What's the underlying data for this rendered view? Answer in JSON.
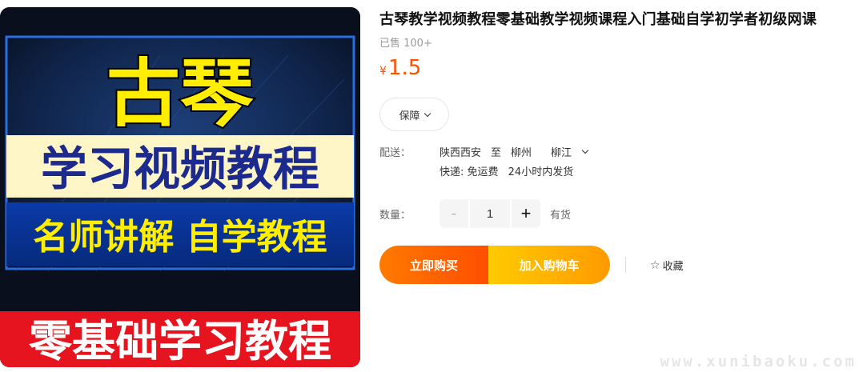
{
  "product": {
    "title": "古琴教学视频教程零基础教学视频课程入门基础自学初学者初级网课",
    "sold": "已售 100+",
    "price_symbol": "¥",
    "price": "1.5",
    "image": {
      "headline": "古琴",
      "subtitle": "学习视频教程",
      "band": "名师讲解 自学教程",
      "footer": "零基础学习教程"
    }
  },
  "guarantee": {
    "label": "保障",
    "icon": "chevron-down-icon"
  },
  "shipping": {
    "label": "配送：",
    "from": "陕西西安",
    "to_word": "至",
    "city": "柳州",
    "district": "柳江",
    "express": "快递: 免运费",
    "dispatch": "24小时内发货"
  },
  "quantity": {
    "label": "数量：",
    "minus": "-",
    "value": "1",
    "plus": "+",
    "stock": "有货"
  },
  "actions": {
    "buy_now": "立即购买",
    "add_cart": "加入购物车",
    "favorite": "收藏",
    "favorite_icon": "star-icon"
  },
  "watermark": "www.xunibaoku.com",
  "colors": {
    "accent": "#ff5000",
    "buy_start": "#ff7a00",
    "cart_start": "#ffcb00"
  }
}
